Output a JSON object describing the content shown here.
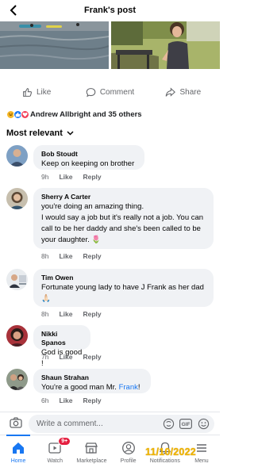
{
  "header": {
    "title": "Frank's post",
    "back_icon": "chevron-left-icon"
  },
  "actions": [
    {
      "label": "Like",
      "icon": "thumbs-up-icon"
    },
    {
      "label": "Comment",
      "icon": "comment-icon"
    },
    {
      "label": "Share",
      "icon": "share-icon"
    }
  ],
  "reactions": {
    "summary": "Andrew Allbright and 35 others",
    "icons": [
      "haha-icon",
      "like-icon",
      "love-icon"
    ]
  },
  "sort": {
    "label": "Most relevant"
  },
  "comments": [
    {
      "name": "Bob Stoudt",
      "lines": [
        "Keep on keeping on brother"
      ],
      "time": "9h",
      "like": "Like",
      "reply": "Reply"
    },
    {
      "name": "Sherry A Carter",
      "lines": [
        "you're doing an amazing thing.",
        "I would say a job but it's really not a job. You can",
        "call to be her daddy and she's been called to be",
        "your daughter. 🌷"
      ],
      "time": "8h",
      "like": "Like",
      "reply": "Reply"
    },
    {
      "name": "Tim Owen",
      "lines": [
        "Fortunate young lady to have J Frank as her dad",
        "🙏🏻"
      ],
      "time": "8h",
      "like": "Like",
      "reply": "Reply"
    },
    {
      "name": "Nikki Spanos",
      "lines": [
        "God is good !"
      ],
      "time": "7h",
      "like": "Like",
      "reply": "Reply"
    },
    {
      "name": "Shaun Strahan",
      "text_prefix": "You're a good man Mr. ",
      "mention": "Frank",
      "text_suffix": "!",
      "time": "6h",
      "like": "Like",
      "reply": "Reply"
    }
  ],
  "composer": {
    "placeholder": "Write a comment..."
  },
  "tabs": [
    {
      "label": "Home",
      "icon": "home-icon",
      "active": true
    },
    {
      "label": "Watch",
      "icon": "watch-icon",
      "badge": "9+"
    },
    {
      "label": "Marketplace",
      "icon": "marketplace-icon"
    },
    {
      "label": "Profile",
      "icon": "profile-icon"
    },
    {
      "label": "Notifications",
      "icon": "bell-icon"
    },
    {
      "label": "Menu",
      "icon": "menu-icon"
    }
  ],
  "date_stamp": "11/10/2022",
  "colors": {
    "accent": "#1877f2",
    "bubble": "#f0f2f5",
    "stamp": "#f0b400"
  }
}
